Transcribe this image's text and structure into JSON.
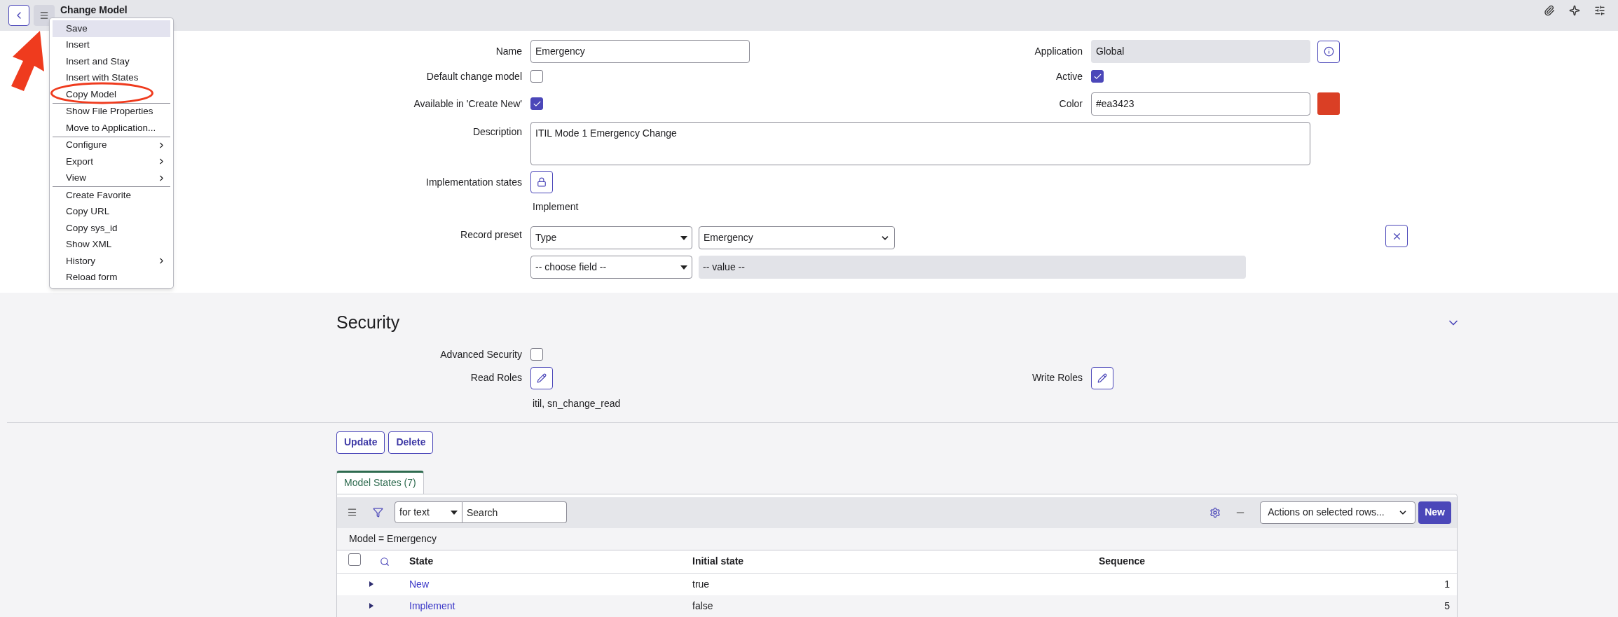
{
  "header": {
    "title": "Change Model"
  },
  "menu": {
    "groups": [
      [
        {
          "label": "Save",
          "selected": true,
          "submenu": false
        },
        {
          "label": "Insert",
          "selected": false,
          "submenu": false
        },
        {
          "label": "Insert and Stay",
          "selected": false,
          "submenu": false
        },
        {
          "label": "Insert with States",
          "selected": false,
          "submenu": false
        },
        {
          "label": "Copy Model",
          "selected": false,
          "submenu": false
        }
      ],
      [
        {
          "label": "Show File Properties",
          "selected": false,
          "submenu": false
        },
        {
          "label": "Move to Application...",
          "selected": false,
          "submenu": false
        }
      ],
      [
        {
          "label": "Configure",
          "selected": false,
          "submenu": true
        },
        {
          "label": "Export",
          "selected": false,
          "submenu": true
        },
        {
          "label": "View",
          "selected": false,
          "submenu": true
        }
      ],
      [
        {
          "label": "Create Favorite",
          "selected": false,
          "submenu": false
        },
        {
          "label": "Copy URL",
          "selected": false,
          "submenu": false
        },
        {
          "label": "Copy sys_id",
          "selected": false,
          "submenu": false
        },
        {
          "label": "Show XML",
          "selected": false,
          "submenu": false
        },
        {
          "label": "History",
          "selected": false,
          "submenu": true
        },
        {
          "label": "Reload form",
          "selected": false,
          "submenu": false
        }
      ]
    ]
  },
  "form": {
    "name": {
      "label": "Name",
      "value": "Emergency"
    },
    "application": {
      "label": "Application",
      "value": "Global"
    },
    "default_change_model": {
      "label": "Default change model",
      "checked": false
    },
    "active": {
      "label": "Active",
      "checked": true
    },
    "available": {
      "label": "Available in 'Create New'",
      "checked": true
    },
    "color": {
      "label": "Color",
      "value": "#ea3423",
      "color": "#da3f25"
    },
    "description": {
      "label": "Description",
      "value": "ITIL Mode 1 Emergency Change"
    },
    "implementation_states": {
      "label": "Implementation states",
      "value": "Implement"
    },
    "record_preset": {
      "label": "Record preset",
      "field": "Type",
      "value": "Emergency",
      "choose_field": "-- choose field --",
      "value_placeholder": "-- value --"
    }
  },
  "security": {
    "title": "Security",
    "advanced_security": {
      "label": "Advanced Security",
      "checked": false
    },
    "read_roles": {
      "label": "Read Roles",
      "value": "itil, sn_change_read"
    },
    "write_roles": {
      "label": "Write Roles"
    }
  },
  "buttons": [
    "Update",
    "Delete"
  ],
  "related_list": {
    "tabs": [
      {
        "label": "Model States (7)",
        "selected": true
      }
    ],
    "search": {
      "filter_by": "for text",
      "placeholder": "Search"
    },
    "actions": "Actions on selected rows...",
    "new_button": "New",
    "breadcrumb": "Model = Emergency",
    "select_all_checked": false,
    "columns": [
      "State",
      "Initial state",
      "Sequence"
    ],
    "rows": [
      {
        "state": "New",
        "initial_state": "true",
        "sequence": "1"
      },
      {
        "state": "Implement",
        "initial_state": "false",
        "sequence": "5"
      }
    ]
  }
}
